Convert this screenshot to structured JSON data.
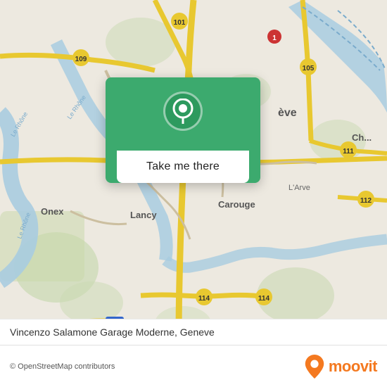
{
  "map": {
    "background_color": "#e8e4dc",
    "roads_color": "#f5c842",
    "water_color": "#b0d4e8",
    "green_areas": "#c8d8b0"
  },
  "card": {
    "background": "#3caa6e",
    "button_label": "Take me there"
  },
  "bottom": {
    "attribution": "© OpenStreetMap contributors",
    "business_name": "Vincenzo Salamone Garage Moderne, Geneve",
    "moovit_label": "moovit"
  }
}
